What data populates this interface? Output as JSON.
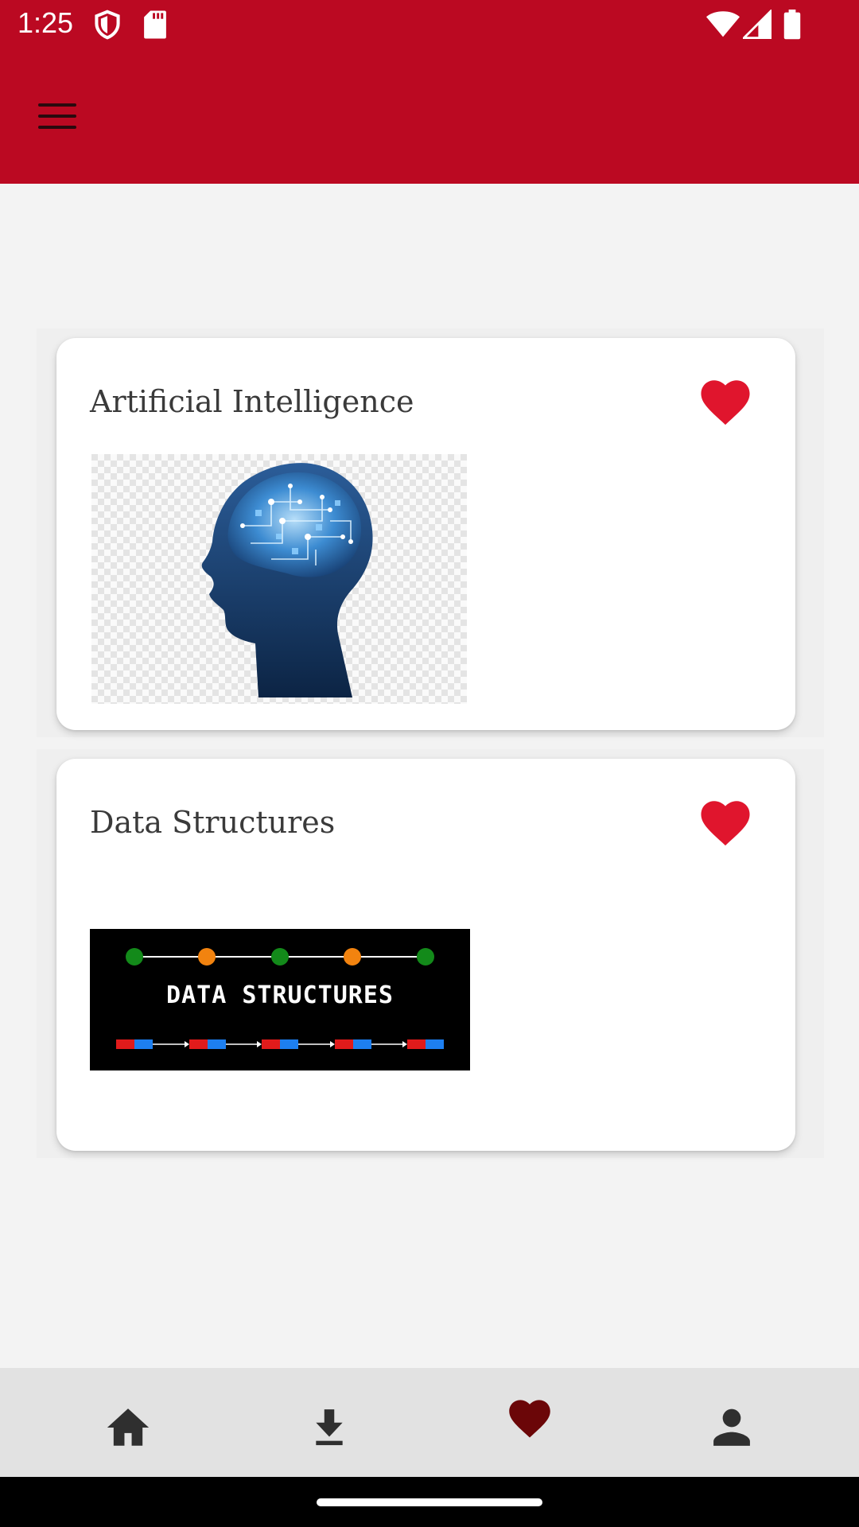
{
  "status_bar": {
    "time": "1:25",
    "icons": [
      "shield-icon",
      "sd-card-icon",
      "wifi-icon",
      "signal-icon",
      "battery-icon"
    ]
  },
  "app_bar": {
    "background": "#bb0922",
    "menu_icon": "menu-icon"
  },
  "favorites": [
    {
      "title": "Artificial Intelligence",
      "favorite_icon": "heart-icon",
      "favorited": true,
      "image": "ai-head-brain-image"
    },
    {
      "title": "Data Structures",
      "favorite_icon": "heart-icon",
      "favorited": true,
      "image": "data-structures-banner-image",
      "image_text": "DATA STRUCTURES"
    }
  ],
  "bottom_nav": {
    "items": [
      {
        "icon": "home-icon",
        "active": false
      },
      {
        "icon": "download-icon",
        "active": false
      },
      {
        "icon": "heart-icon",
        "active": true
      },
      {
        "icon": "person-icon",
        "active": false
      }
    ],
    "active_color": "#6b0608",
    "inactive_color": "#2f2f2f"
  },
  "colors": {
    "accent": "#bb0922",
    "heart": "#e0152d"
  }
}
